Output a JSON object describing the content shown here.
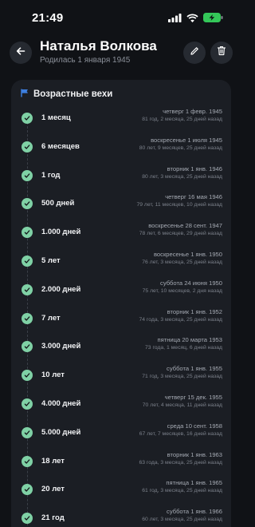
{
  "status": {
    "time": "21:49",
    "icons": [
      "cellular-signal-icon",
      "wifi-icon",
      "battery-charging-icon"
    ]
  },
  "header": {
    "title": "Наталья Волкова",
    "subtitle": "Родилась 1 января 1945",
    "back_icon": "arrow-left-icon",
    "edit_icon": "pencil-icon",
    "delete_icon": "trash-icon"
  },
  "card": {
    "title": "Возрастные вехи",
    "icon": "flag-icon",
    "accent": "#7fd1a5"
  },
  "milestones": [
    {
      "label": "1 месяц",
      "date": "четверг 1 февр. 1945",
      "ago": "81 год, 2 месяца, 25 дней назад"
    },
    {
      "label": "6 месяцев",
      "date": "воскресенье 1 июля 1945",
      "ago": "80 лет, 9 месяцев, 25 дней назад"
    },
    {
      "label": "1 год",
      "date": "вторник 1 янв. 1946",
      "ago": "80 лет, 3 месяца, 25 дней назад"
    },
    {
      "label": "500 дней",
      "date": "четверг 16 мая 1946",
      "ago": "79 лет, 11 месяцев, 10 дней назад"
    },
    {
      "label": "1.000 дней",
      "date": "воскресенье 28 сент. 1947",
      "ago": "78 лет, 6 месяцев, 29 дней назад"
    },
    {
      "label": "5 лет",
      "date": "воскресенье 1 янв. 1950",
      "ago": "76 лет, 3 месяца, 25 дней назад"
    },
    {
      "label": "2.000 дней",
      "date": "суббота 24 июня 1950",
      "ago": "75 лет, 10 месяцев, 2 дня назад"
    },
    {
      "label": "7 лет",
      "date": "вторник 1 янв. 1952",
      "ago": "74 года, 3 месяца, 25 дней назад"
    },
    {
      "label": "3.000 дней",
      "date": "пятница 20 марта 1953",
      "ago": "73 года, 1 месяц, 6 дней назад"
    },
    {
      "label": "10 лет",
      "date": "суббота 1 янв. 1955",
      "ago": "71 год, 3 месяца, 25 дней назад"
    },
    {
      "label": "4.000 дней",
      "date": "четверг 15 дек. 1955",
      "ago": "70 лет, 4 месяца, 11 дней назад"
    },
    {
      "label": "5.000 дней",
      "date": "среда 10 сент. 1958",
      "ago": "67 лет, 7 месяцев, 16 дней назад"
    },
    {
      "label": "18 лет",
      "date": "вторник 1 янв. 1963",
      "ago": "63 года, 3 месяца, 25 дней назад"
    },
    {
      "label": "20 лет",
      "date": "пятница 1 янв. 1965",
      "ago": "61 год, 3 месяца, 25 дней назад"
    },
    {
      "label": "21 год",
      "date": "суббота 1 янв. 1966",
      "ago": "60 лет, 3 месяца, 25 дней назад"
    }
  ]
}
